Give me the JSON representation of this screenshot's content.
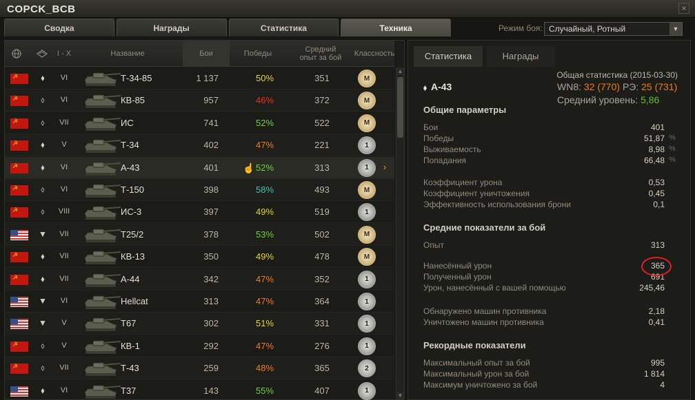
{
  "window": {
    "title": "COPCK_BCB",
    "close_glyph": "×"
  },
  "tabs": [
    {
      "label": "Сводка"
    },
    {
      "label": "Награды"
    },
    {
      "label": "Статистика"
    },
    {
      "label": "Техника"
    }
  ],
  "battle_mode": {
    "label": "Режим боя:",
    "value": "Случайный, Ротный"
  },
  "table": {
    "headers": {
      "nation_icon": "globe-icon",
      "class_icon": "tank-class-icon",
      "tier": "I - X",
      "name": "Название",
      "battles": "Бои",
      "wins": "Победы",
      "avg_xp": "Средний опыт за бой",
      "mastery": "Классность"
    },
    "rows": [
      {
        "nation": "ussr",
        "cls": "⬧",
        "tier": "VI",
        "name": "Т-34-85",
        "battles": "1 137",
        "wins": "50%",
        "wins_color": "#e8d520",
        "avg_xp": "351",
        "mastery": "M",
        "mastery_type": "m"
      },
      {
        "nation": "ussr",
        "cls": "⬨",
        "tier": "VI",
        "name": "КВ-85",
        "battles": "957",
        "wins": "46%",
        "wins_color": "#e8331c",
        "avg_xp": "372",
        "mastery": "M",
        "mastery_type": "m"
      },
      {
        "nation": "ussr",
        "cls": "⬨",
        "tier": "VII",
        "name": "ИС",
        "battles": "741",
        "wins": "52%",
        "wins_color": "#73d036",
        "avg_xp": "522",
        "mastery": "M",
        "mastery_type": "m"
      },
      {
        "nation": "ussr",
        "cls": "⬧",
        "tier": "V",
        "name": "Т-34",
        "battles": "402",
        "wins": "47%",
        "wins_color": "#f07a1a",
        "avg_xp": "221",
        "mastery": "1",
        "mastery_type": "n1"
      },
      {
        "nation": "ussr",
        "cls": "⬧",
        "tier": "VI",
        "name": "А-43",
        "battles": "401",
        "wins": "52%",
        "wins_color": "#73d036",
        "avg_xp": "313",
        "mastery": "1",
        "mastery_type": "n1",
        "selected": true
      },
      {
        "nation": "ussr",
        "cls": "⬨",
        "tier": "VI",
        "name": "Т-150",
        "battles": "398",
        "wins": "58%",
        "wins_color": "#3cc5b8",
        "avg_xp": "493",
        "mastery": "M",
        "mastery_type": "m"
      },
      {
        "nation": "ussr",
        "cls": "⬨",
        "tier": "VIII",
        "name": "ИС-3",
        "battles": "397",
        "wins": "49%",
        "wins_color": "#e8d520",
        "avg_xp": "519",
        "mastery": "1",
        "mastery_type": "n1"
      },
      {
        "nation": "usa",
        "cls": "▼",
        "tier": "VII",
        "name": "T25/2",
        "battles": "378",
        "wins": "53%",
        "wins_color": "#73d036",
        "avg_xp": "502",
        "mastery": "M",
        "mastery_type": "m"
      },
      {
        "nation": "ussr",
        "cls": "⬧",
        "tier": "VII",
        "name": "КВ-13",
        "battles": "350",
        "wins": "49%",
        "wins_color": "#e8d520",
        "avg_xp": "478",
        "mastery": "M",
        "mastery_type": "m"
      },
      {
        "nation": "ussr",
        "cls": "⬧",
        "tier": "VII",
        "name": "А-44",
        "battles": "342",
        "wins": "47%",
        "wins_color": "#f07a1a",
        "avg_xp": "352",
        "mastery": "1",
        "mastery_type": "n1"
      },
      {
        "nation": "usa",
        "cls": "▼",
        "tier": "VI",
        "name": "Hellcat",
        "battles": "313",
        "wins": "47%",
        "wins_color": "#f07a1a",
        "avg_xp": "364",
        "mastery": "1",
        "mastery_type": "n1"
      },
      {
        "nation": "usa",
        "cls": "▼",
        "tier": "V",
        "name": "T67",
        "battles": "302",
        "wins": "51%",
        "wins_color": "#e8d520",
        "avg_xp": "331",
        "mastery": "1",
        "mastery_type": "n1"
      },
      {
        "nation": "ussr",
        "cls": "⬨",
        "tier": "V",
        "name": "КВ-1",
        "battles": "292",
        "wins": "47%",
        "wins_color": "#f07a1a",
        "avg_xp": "276",
        "mastery": "1",
        "mastery_type": "n1"
      },
      {
        "nation": "ussr",
        "cls": "⬨",
        "tier": "VII",
        "name": "Т-43",
        "battles": "259",
        "wins": "48%",
        "wins_color": "#f07a1a",
        "avg_xp": "365",
        "mastery": "2",
        "mastery_type": "n2"
      },
      {
        "nation": "usa",
        "cls": "⬧",
        "tier": "VI",
        "name": "T37",
        "battles": "143",
        "wins": "55%",
        "wins_color": "#73d036",
        "avg_xp": "407",
        "mastery": "1",
        "mastery_type": "n1"
      }
    ],
    "selected_chevron": "›"
  },
  "detail": {
    "tabs": [
      {
        "label": "Статистика"
      },
      {
        "label": "Награды"
      }
    ],
    "overall_label": "Общая статистика (2015-03-30)",
    "wn8_label": "WN8:",
    "wn8_value": "32",
    "wn8_paren": "(770)",
    "re_label": "РЭ:",
    "re_value": "25",
    "re_paren": "(731)",
    "avg_level_label": "Средний уровень:",
    "avg_level_value": "5,86",
    "tank_name": "А-43",
    "sections": {
      "general": "Общие параметры",
      "avg": "Средние показатели за бой",
      "records": "Рекордные показатели"
    },
    "general_stats": [
      {
        "label": "Бои",
        "value": "401",
        "unit": ""
      },
      {
        "label": "Победы",
        "value": "51,87",
        "unit": "%"
      },
      {
        "label": "Выживаемость",
        "value": "8,98",
        "unit": "%"
      },
      {
        "label": "Попадания",
        "value": "66,48",
        "unit": "%"
      }
    ],
    "coef_stats": [
      {
        "label": "Коэффициент урона",
        "value": "0,53"
      },
      {
        "label": "Коэффициент уничтожения",
        "value": "0,45"
      },
      {
        "label": "Эффективность использования брони",
        "value": "0,1"
      }
    ],
    "avg_xp": {
      "label": "Опыт",
      "value": "313"
    },
    "avg_damage_stats": [
      {
        "label": "Нанесённый урон",
        "value": "365"
      },
      {
        "label": "Полученный урон",
        "value": "691"
      },
      {
        "label": "Урон, нанесённый с вашей помощью",
        "value": "245,46"
      }
    ],
    "avg_kill_stats": [
      {
        "label": "Обнаружено машин противника",
        "value": "2,18"
      },
      {
        "label": "Уничтожено машин противника",
        "value": "0,41"
      }
    ],
    "record_stats": [
      {
        "label": "Максимальный опыт за бой",
        "value": "995"
      },
      {
        "label": "Максимальный урон за бой",
        "value": "1 814"
      },
      {
        "label": "Максимум уничтожено за бой",
        "value": "4"
      }
    ]
  }
}
